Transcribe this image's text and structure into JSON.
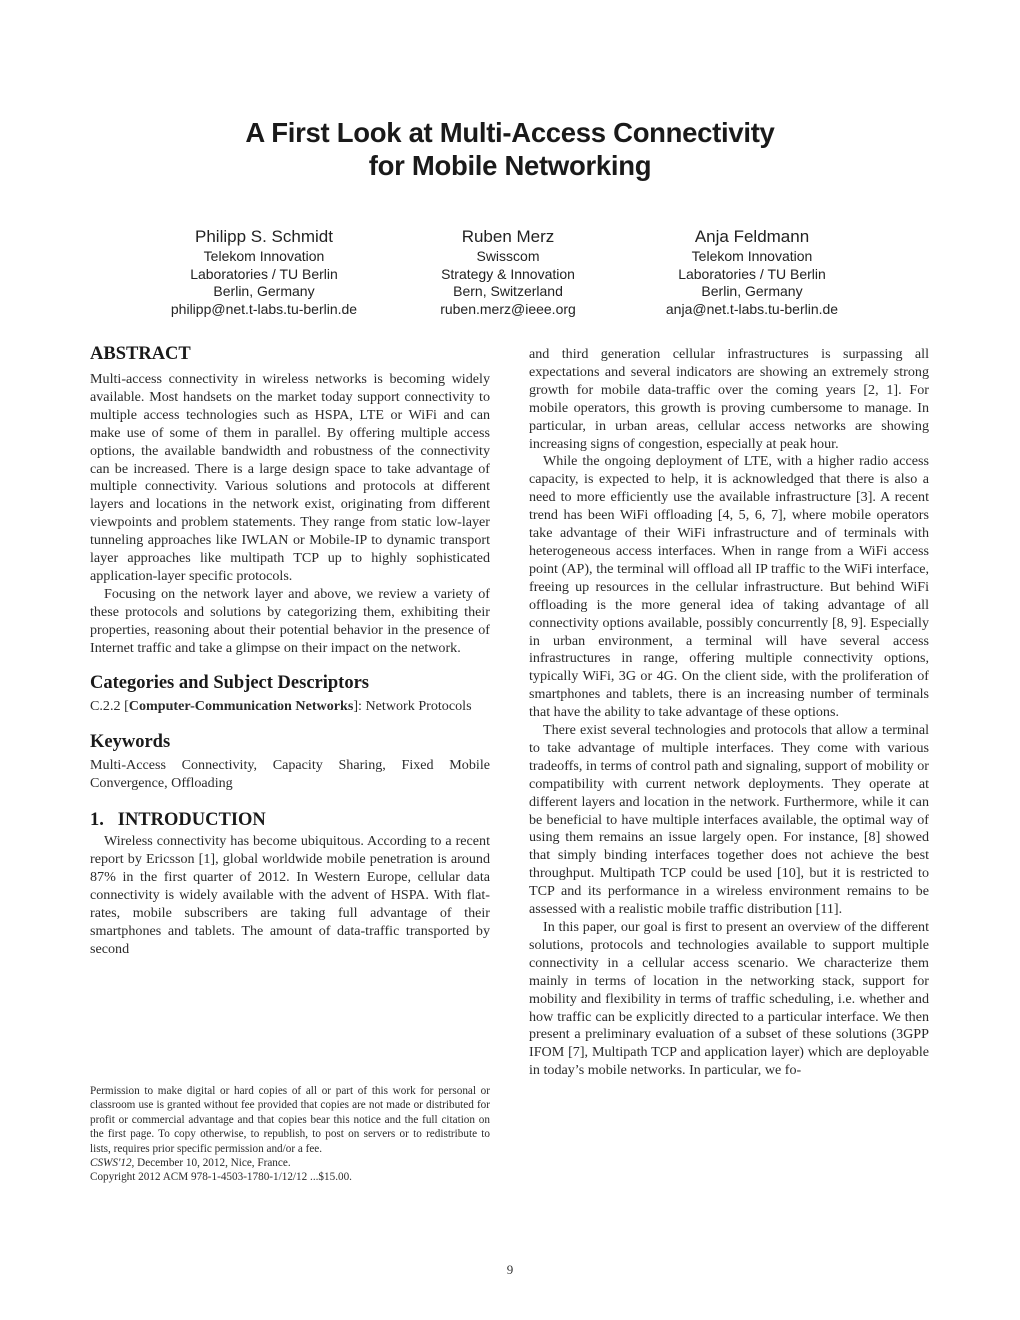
{
  "paper": {
    "title_lines": [
      "A First Look at Multi-Access Connectivity",
      "for Mobile Networking"
    ],
    "authors": [
      {
        "name": "Philipp S. Schmidt",
        "affiliation_lines": [
          "Telekom Innovation",
          "Laboratories / TU Berlin",
          "Berlin, Germany"
        ],
        "email": "philipp@net.t-labs.tu-berlin.de"
      },
      {
        "name": "Ruben Merz",
        "affiliation_lines": [
          "Swisscom",
          "Strategy & Innovation",
          "Bern, Switzerland"
        ],
        "email": "ruben.merz@ieee.org"
      },
      {
        "name": "Anja Feldmann",
        "affiliation_lines": [
          "Telekom Innovation",
          "Laboratories / TU Berlin",
          "Berlin, Germany"
        ],
        "email": "anja@net.t-labs.tu-berlin.de"
      }
    ],
    "abstract": {
      "heading": "ABSTRACT",
      "paragraphs": [
        "Multi-access connectivity in wireless networks is becoming widely available. Most handsets on the market today sup­port connectivity to multiple access technologies such as HSPA, LTE or WiFi and can make use of some of them in parallel. By offering multiple access options, the avail­able bandwidth and robustness of the connectivity can be increased. There is a large design space to take advantage of multiple connectivity. Various solutions and protocols at different layers and locations in the network exist, orig­inating from different viewpoints and problem statements. They range from static low-layer tunneling approaches like IWLAN or Mobile-IP to dynamic transport layer approaches like multipath TCP up to highly sophisticated application-layer specific protocols.",
        "Focusing on the network layer and above, we review a va­riety of these protocols and solutions by categorizing them, exhibiting their properties, reasoning about their potential behavior in the presence of Internet traffic and take a glimpse on their impact on the network."
      ]
    },
    "categories": {
      "heading": "Categories and Subject Descriptors",
      "code": "C.2.2 [",
      "bold_term": "Computer-Communication Networks",
      "rest": "]: Network Protocols"
    },
    "keywords": {
      "heading": "Keywords",
      "text": "Multi-Access Connectivity, Capacity Sharing, Fixed Mobile Convergence, Offloading"
    },
    "introduction": {
      "heading": "1.   INTRODUCTION",
      "left_paragraph": "Wireless connectivity has become ubiquitous. According to a recent report by Ericsson [1], global worldwide mobile penetration is around 87% in the first quarter of 2012. In Western Europe, cellular data connectivity is widely avail­able with the advent of HSPA. With flat-rates, mobile sub­scribers are taking full advantage of their smartphones and tablets. The amount of data-traffic transported by second",
      "right_paragraphs": [
        {
          "indent": false,
          "text": "and third generation cellular infrastructures is surpassing all expectations and several indicators are showing an ex­tremely strong growth for mobile data-traffic over the com­ing years [2, 1]. For mobile operators, this growth is prov­ing cumbersome to manage. In particular, in urban areas, cellular access networks are showing increasing signs of con­gestion, especially at peak hour."
        },
        {
          "indent": true,
          "text": "While the ongoing deployment of LTE, with a higher ra­dio access capacity, is expected to help, it is acknowledged that there is also a need to more efficiently use the available infrastructure [3]. A recent trend has been WiFi offload­ing [4, 5, 6, 7], where mobile operators take advantage of their WiFi infrastructure and of terminals with heteroge­neous access interfaces. When in range from a WiFi access point (AP), the terminal will offload all IP traffic to the WiFi interface, freeing up resources in the cellular infrastructure. But behind WiFi offloading is the more general idea of tak­ing advantage of all connectivity options available, possibly concurrently [8, 9]. Especially in urban environment, a ter­minal will have several access infrastructures in range, of­fering multiple connectivity options, typically WiFi, 3G or 4G. On the client side, with the proliferation of smartphones and tablets, there is an increasing number of terminals that have the ability to take advantage of these options."
        },
        {
          "indent": true,
          "text": "There exist several technologies and protocols that allow a terminal to take advantage of multiple interfaces. They come with various tradeoffs, in terms of control path and signaling, support of mobility or compatibility with cur­rent network deployments. They operate at different lay­ers and location in the network. Furthermore, while it can be beneficial to have multiple interfaces available, the opti­mal way of using them remains an issue largely open. For instance, [8] showed that simply binding interfaces together does not achieve the best throughput. Multipath TCP could be used [10], but it is restricted to TCP and its performance in a wireless environment remains to be assessed with a re­alistic mobile traffic distribution [11]."
        },
        {
          "indent": true,
          "text": "In this paper, our goal is first to present an overview of the different solutions, protocols and technologies available to support multiple connectivity in a cellular access scenario. We characterize them mainly in terms of location in the net­working stack, support for mobility and flexibility in terms of traffic scheduling, i.e. whether and how traffic can be ex­plicitly directed to a particular interface. We then present a preliminary evaluation of a subset of these solutions (3GPP IFOM [7], Multipath TCP and application layer) which are deployable in today’s mobile networks. In particular, we fo-"
        }
      ]
    },
    "permission_notice": {
      "text": "Permission to make digital or hard copies of all or part of this work for personal or classroom use is granted without fee provided that copies are not made or distributed for profit or commercial advantage and that copies bear this notice and the full citation on the first page. To copy otherwise, to republish, to post on servers or to redistribute to lists, requires prior specific permission and/or a fee.",
      "venue_italic": "CSWS'12,",
      "venue_rest": " December 10, 2012, Nice, France.",
      "copyright": "Copyright 2012 ACM 978-1-4503-1780-1/12/12 ...$15.00."
    },
    "page_number": "9"
  }
}
